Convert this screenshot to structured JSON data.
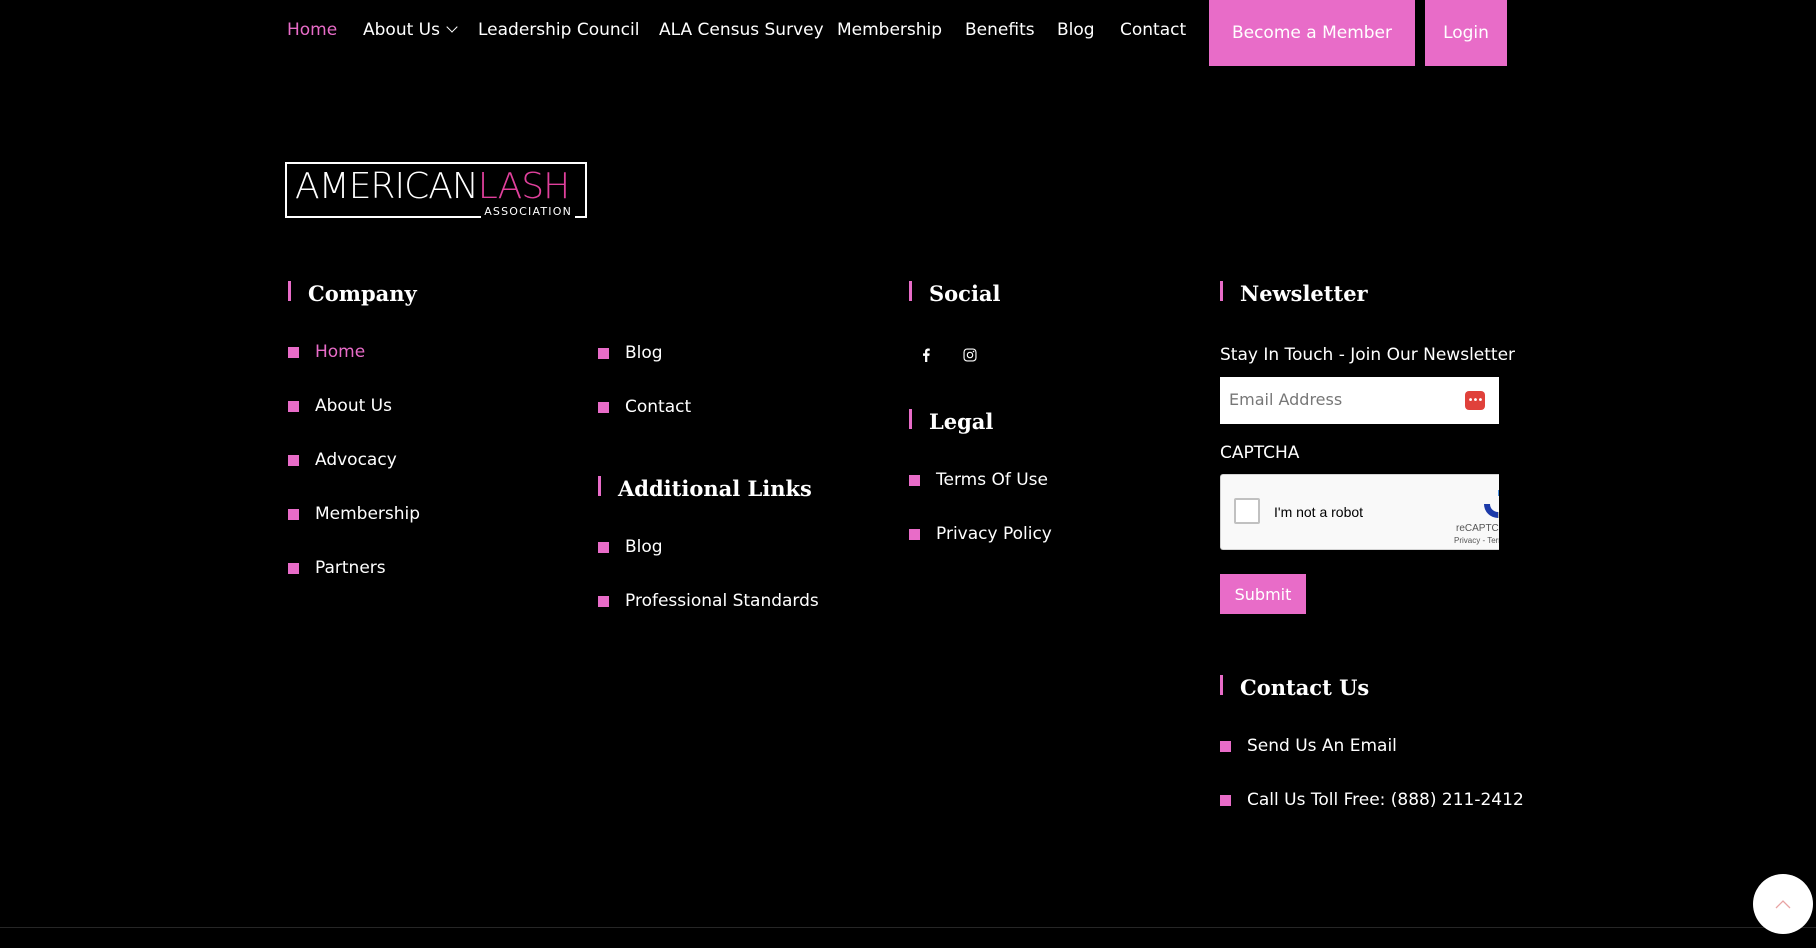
{
  "nav": {
    "home": "Home",
    "about": "About Us",
    "leadership": "Leadership Council",
    "census": "ALA Census Survey",
    "membership": "Membership",
    "benefits": "Benefits",
    "blog": "Blog",
    "contact": "Contact",
    "become_member": "Become a Member",
    "login": "Login"
  },
  "logo": {
    "main_white": "AMERICAN",
    "main_pink": "LASH",
    "sub": "ASSOCIATION"
  },
  "company": {
    "heading": "Company",
    "col1": [
      "Home",
      "About Us",
      "Advocacy",
      "Membership",
      "Partners"
    ],
    "col2": [
      "Blog",
      "Contact"
    ]
  },
  "additional": {
    "heading": "Additional Links",
    "items": [
      "Blog",
      "Professional Standards"
    ]
  },
  "social": {
    "heading": "Social",
    "icons": [
      "facebook-icon",
      "instagram-icon"
    ]
  },
  "legal": {
    "heading": "Legal",
    "items": [
      "Terms Of Use",
      "Privacy Policy"
    ]
  },
  "newsletter": {
    "heading": "Newsletter",
    "tagline": "Stay In Touch - Join Our Newsletter",
    "email_placeholder": "Email Address",
    "captcha_label": "CAPTCHA",
    "captcha_text": "I'm not a robot",
    "recaptcha_label": "reCAPTCHA",
    "recaptcha_terms": "Privacy - Terms",
    "submit": "Submit"
  },
  "contact": {
    "heading": "Contact Us",
    "email": "Send Us An Email",
    "phone": "Call Us Toll Free: (888) 211-2412"
  },
  "colors": {
    "accent": "#e86cc8",
    "background": "#000000"
  }
}
